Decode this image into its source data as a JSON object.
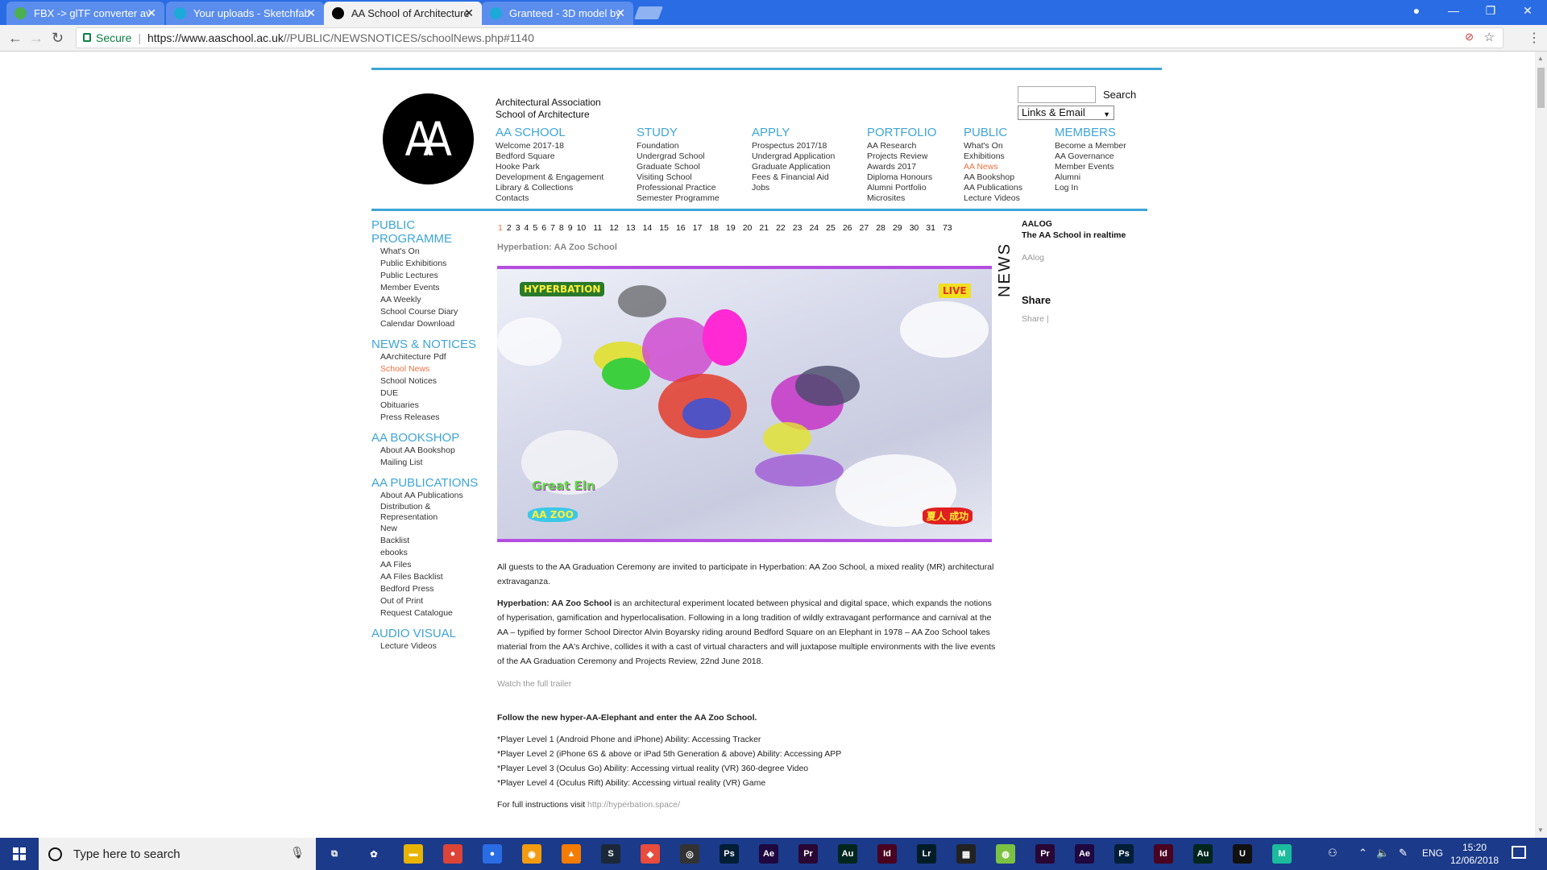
{
  "browser": {
    "tabs": [
      {
        "label": "FBX -> glTF converter av",
        "active": false,
        "icon_color": "#4caf50"
      },
      {
        "label": "Your uploads - Sketchfab",
        "active": false,
        "icon_color": "#1caad9"
      },
      {
        "label": "AA School of Architecture",
        "active": true,
        "icon_color": "#000000"
      },
      {
        "label": "Granteed - 3D model by",
        "active": false,
        "icon_color": "#1caad9"
      }
    ],
    "secure_label": "Secure",
    "url_host": "https://www.aaschool.ac.uk",
    "url_path": "//PUBLIC/NEWSNOTICES/schoolNews.php#1140"
  },
  "site": {
    "logo_text": "AA",
    "org_line1": "Architectural Association",
    "org_line2": "School of Architecture",
    "search_button": "Search",
    "links_select": "Links & Email",
    "menus": [
      {
        "heading": "AA SCHOOL",
        "items": [
          "Welcome 2017-18",
          "Bedford Square",
          "Hooke Park",
          "Development & Engagement",
          "Library & Collections",
          "Contacts"
        ]
      },
      {
        "heading": "STUDY",
        "items": [
          "Foundation",
          "Undergrad School",
          "Graduate School",
          "Visiting School",
          "Professional Practice",
          "Semester Programme"
        ]
      },
      {
        "heading": "APPLY",
        "items": [
          "Prospectus 2017/18",
          "Undergrad Application",
          "Graduate Application",
          "Fees & Financial Aid",
          "Jobs"
        ]
      },
      {
        "heading": "PORTFOLIO",
        "items": [
          "AA Research",
          "Projects Review",
          "Awards 2017",
          "Diploma Honours",
          "Alumni Portfolio",
          "Microsites"
        ]
      },
      {
        "heading": "PUBLIC",
        "items": [
          "What's On",
          "Exhibitions",
          "AA News",
          "AA Bookshop",
          "AA Publications",
          "Lecture Videos"
        ]
      },
      {
        "heading": "MEMBERS",
        "items": [
          "Become a Member",
          "AA Governance",
          "Member Events",
          "Alumni",
          "Log In"
        ]
      }
    ],
    "sidebar": [
      {
        "heading": "PUBLIC PROGRAMME",
        "items": [
          "What's On",
          "Public Exhibitions",
          "Public Lectures",
          "Member Events",
          "AA Weekly",
          "School Course Diary",
          "Calendar Download"
        ]
      },
      {
        "heading": "NEWS & NOTICES",
        "items": [
          "AArchitecture Pdf",
          "School News",
          "School Notices",
          "DUE",
          "Obituaries",
          "Press Releases"
        ]
      },
      {
        "heading": "AA BOOKSHOP",
        "items": [
          "About AA Bookshop",
          "Mailing List"
        ]
      },
      {
        "heading": "AA PUBLICATIONS",
        "items": [
          "About AA Publications",
          "Distribution &",
          "Representation",
          "New",
          "Backlist",
          "ebooks",
          "AA Files",
          "AA Files Backlist",
          "Bedford Press",
          "Out of Print",
          "Request Catalogue"
        ]
      },
      {
        "heading": "AUDIO VISUAL",
        "items": [
          "Lecture Videos"
        ]
      }
    ],
    "pager": [
      "1",
      "2",
      "3",
      "4",
      "5",
      "6",
      "7",
      "8",
      "9",
      "10",
      "11",
      "12",
      "13",
      "14",
      "15",
      "16",
      "17",
      "18",
      "19",
      "20",
      "21",
      "22",
      "23",
      "24",
      "25",
      "26",
      "27",
      "28",
      "29",
      "30",
      "31",
      "73"
    ],
    "article_title": "Hyperbation: AA Zoo School",
    "hero_labels": {
      "tl": "HYPERBATION",
      "tr": "LIVE",
      "ml": "Great Eln",
      "bl": "AA ZOO",
      "br": "夏人 成功"
    },
    "news_vertical": "NEWS",
    "aalog": {
      "heading": "AALOG",
      "sub": "The AA School in realtime",
      "link": "AAlog"
    },
    "share": {
      "heading": "Share",
      "link": "Share |"
    },
    "content": {
      "p1": "All guests to the AA Graduation Ceremony are invited to participate in Hyperbation: AA Zoo School, a mixed reality (MR) architectural extravaganza.",
      "p2_bold": "Hyperbation: AA Zoo School",
      "p2_rest": " is an architectural experiment located between physical and digital space, which expands the notions of hyperisation, gamification and hyperlocalisation. Following in a long tradition of wildly extravagant performance and carnival at the AA – typified by former School Director Alvin Boyarsky riding around Bedford Square on an Elephant in 1978 – AA Zoo School takes material from the AA's Archive, collides it with a cast of virtual characters and will juxtapose multiple environments with the live events of the AA Graduation Ceremony and Projects Review, 22nd June 2018.",
      "trailer": "Watch the full trailer",
      "follow": "Follow the new hyper-AA-Elephant and enter the AA Zoo School.",
      "levels": [
        "*Player Level 1 (Android Phone and iPhone) Ability: Accessing Tracker",
        "*Player Level 2 (iPhone 6S & above or iPad 5th Generation & above) Ability: Accessing APP",
        "*Player Level 3 (Oculus Go) Ability: Accessing virtual reality (VR) 360-degree Video",
        "*Player Level 4 (Oculus Rift) Ability: Accessing virtual reality (VR) Game"
      ],
      "instructions_prefix": "For full instructions visit ",
      "instructions_link": "http://hyperbation.space/"
    }
  },
  "taskbar": {
    "search_placeholder": "Type here to search",
    "lang": "ENG",
    "time": "15:20",
    "date": "12/06/2018",
    "apps": [
      {
        "name": "task-view",
        "label": "⧉",
        "color": "#1b3a8a"
      },
      {
        "name": "app-flower",
        "label": "✿",
        "color": "#1b3a8a"
      },
      {
        "name": "file-explorer",
        "label": "▬",
        "color": "#e8b400"
      },
      {
        "name": "chrome",
        "label": "●",
        "color": "#db4437"
      },
      {
        "name": "chrome-alt",
        "label": "●",
        "color": "#2a6ce4"
      },
      {
        "name": "app-orange",
        "label": "◉",
        "color": "#f39c12"
      },
      {
        "name": "vlc",
        "label": "▲",
        "color": "#f57c00"
      },
      {
        "name": "steam",
        "label": "S",
        "color": "#1b2838"
      },
      {
        "name": "app-red",
        "label": "◆",
        "color": "#e74c3c"
      },
      {
        "name": "app-disc",
        "label": "◎",
        "color": "#333333"
      },
      {
        "name": "photoshop",
        "label": "Ps",
        "color": "#001e36"
      },
      {
        "name": "after-effects",
        "label": "Ae",
        "color": "#1f0740"
      },
      {
        "name": "premiere",
        "label": "Pr",
        "color": "#2a0634"
      },
      {
        "name": "audition",
        "label": "Au",
        "color": "#00261d"
      },
      {
        "name": "indesign",
        "label": "Id",
        "color": "#49021f"
      },
      {
        "name": "lightroom",
        "label": "Lr",
        "color": "#001d26"
      },
      {
        "name": "app-dark",
        "label": "▦",
        "color": "#222222"
      },
      {
        "name": "app-green",
        "label": "◍",
        "color": "#7cc242"
      },
      {
        "name": "premiere-2",
        "label": "Pr",
        "color": "#2a0634"
      },
      {
        "name": "after-effects-2",
        "label": "Ae",
        "color": "#1f0740"
      },
      {
        "name": "photoshop-2",
        "label": "Ps",
        "color": "#001e36"
      },
      {
        "name": "indesign-2",
        "label": "Id",
        "color": "#49021f"
      },
      {
        "name": "audition-2",
        "label": "Au",
        "color": "#00261d"
      },
      {
        "name": "unreal",
        "label": "U",
        "color": "#111111"
      },
      {
        "name": "app-m",
        "label": "M",
        "color": "#1abc9c"
      }
    ]
  }
}
